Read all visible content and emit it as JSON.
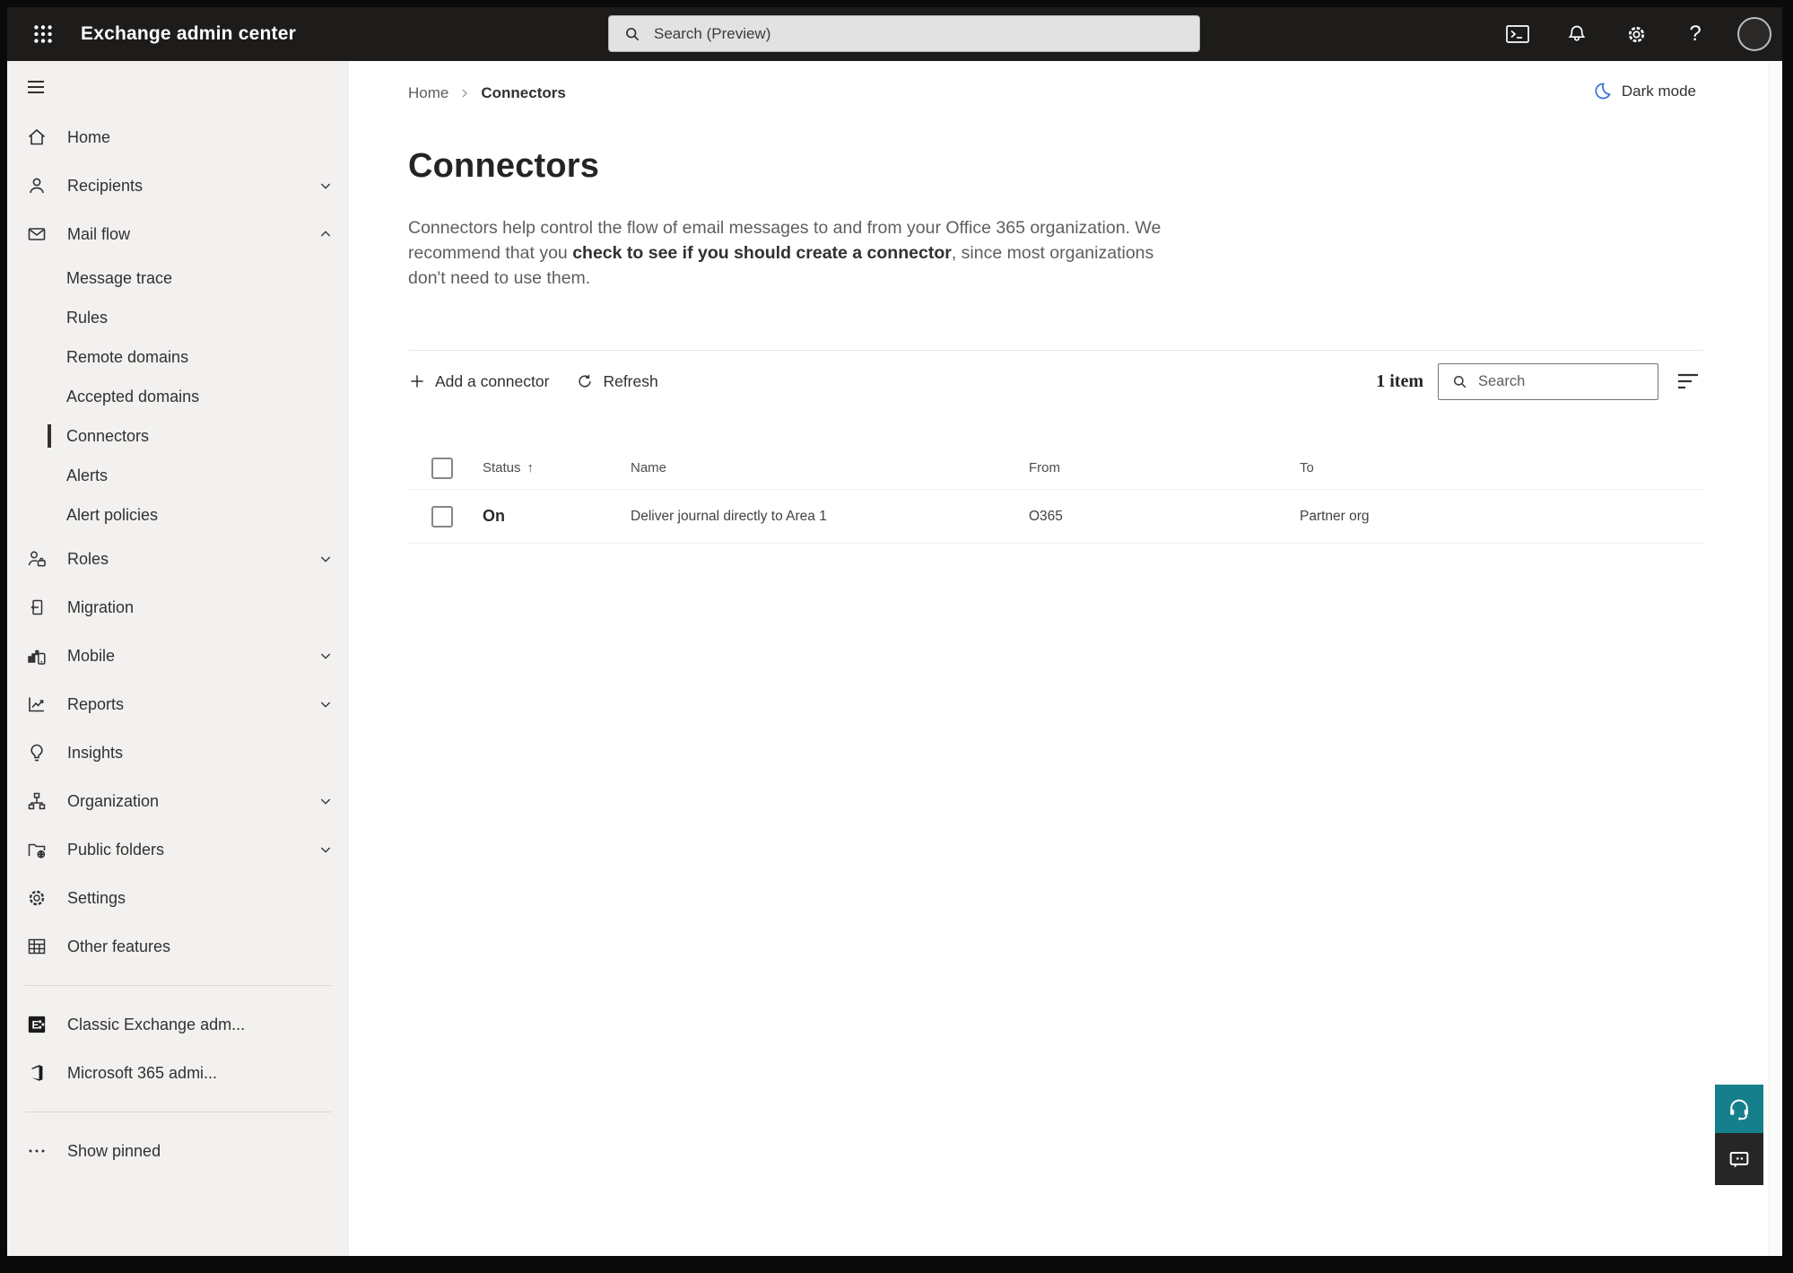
{
  "topbar": {
    "app_title": "Exchange admin center",
    "search_placeholder": "Search (Preview)",
    "help_glyph": "?"
  },
  "sidebar": {
    "items": [
      {
        "label": "Home"
      },
      {
        "label": "Recipients",
        "chevron": "down"
      },
      {
        "label": "Mail flow",
        "chevron": "up",
        "expanded": true
      },
      {
        "label": "Message trace",
        "sub": true
      },
      {
        "label": "Rules",
        "sub": true
      },
      {
        "label": "Remote domains",
        "sub": true
      },
      {
        "label": "Accepted domains",
        "sub": true
      },
      {
        "label": "Connectors",
        "sub": true,
        "selected": true
      },
      {
        "label": "Alerts",
        "sub": true
      },
      {
        "label": "Alert policies",
        "sub": true
      },
      {
        "label": "Roles",
        "chevron": "down"
      },
      {
        "label": "Migration"
      },
      {
        "label": "Mobile",
        "chevron": "down"
      },
      {
        "label": "Reports",
        "chevron": "down"
      },
      {
        "label": "Insights"
      },
      {
        "label": "Organization",
        "chevron": "down"
      },
      {
        "label": "Public folders",
        "chevron": "down"
      },
      {
        "label": "Settings"
      },
      {
        "label": "Other features"
      },
      {
        "label": "Classic Exchange adm...",
        "external": true
      },
      {
        "label": "Microsoft 365 admi...",
        "external": true
      },
      {
        "label": "Show pinned"
      }
    ]
  },
  "page": {
    "breadcrumb": {
      "home": "Home",
      "current": "Connectors"
    },
    "dark_mode_label": "Dark mode",
    "title": "Connectors",
    "description": {
      "part1": "Connectors help control the flow of email messages to and from your Office 365 organization. We recommend that you ",
      "emphasis": "check to see if you should create a connector",
      "part2": ", since most organizations don't need to use them."
    },
    "toolbar": {
      "add_connector": "Add a connector",
      "refresh": "Refresh",
      "item_count": "1 item",
      "search_placeholder": "Search"
    },
    "table": {
      "headers": {
        "status": "Status",
        "name": "Name",
        "from": "From",
        "to": "To"
      },
      "sort": {
        "column": "Status",
        "direction": "ascending",
        "arrow": "↑"
      },
      "rows": [
        {
          "status": "On",
          "name": "Deliver journal directly to Area 1",
          "from": "O365",
          "to": "Partner org"
        }
      ]
    }
  },
  "icons": {
    "waffle": "app-launcher grid of 9 dots",
    "terminal": "powershell window",
    "bell": "notifications",
    "gear": "settings",
    "help": "?",
    "avatar": "account circle",
    "dark_mode": "crescent moon",
    "add": "+",
    "refresh": "circular arrow",
    "search": "magnifier",
    "filter": "three shrinking lines",
    "support": "headset",
    "feedback": "speech bubble"
  },
  "colors": {
    "topbar_bg": "#1d1c1b",
    "sidebar_bg": "#f2f1f0",
    "selected_indicator": "#323130",
    "dark_mode_blue": "#3a6fd8",
    "support_teal": "#15808c",
    "feedback_dark": "#262626"
  }
}
